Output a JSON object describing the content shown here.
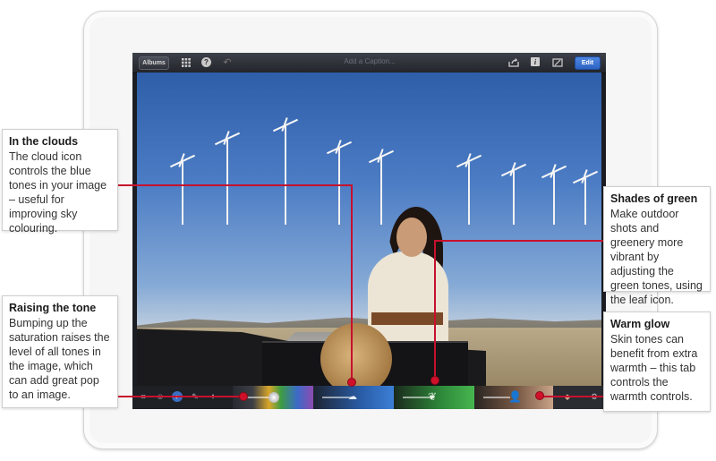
{
  "toolbar": {
    "albums_label": "Albums",
    "caption_placeholder": "Add a Caption...",
    "edit_label": "Edit"
  },
  "icons": {
    "grid": "grid-icon",
    "help": "help-icon",
    "undo": "undo-icon",
    "share": "share-icon",
    "info": "info-icon",
    "crop": "crop-icon",
    "cloud": "cloud-icon",
    "leaf": "leaf-icon",
    "person": "person-icon"
  },
  "callouts": {
    "clouds": {
      "title": "In the clouds",
      "body": "The cloud icon controls the blue tones in your image – useful for improving sky colouring."
    },
    "tone": {
      "title": "Raising the tone",
      "body": "Bumping up the saturation raises the level of all tones in the image, which can add great pop to an image."
    },
    "green": {
      "title": "Shades of green",
      "body": "Make outdoor shots and greenery more vibrant by adjusting the green tones, using the leaf icon."
    },
    "warm": {
      "title": "Warm glow",
      "body": "Skin tones can benefit from extra warmth – this tab controls the warmth controls."
    }
  },
  "colors": {
    "accent_red": "#c8102e",
    "edit_blue": "#2c63c4"
  }
}
